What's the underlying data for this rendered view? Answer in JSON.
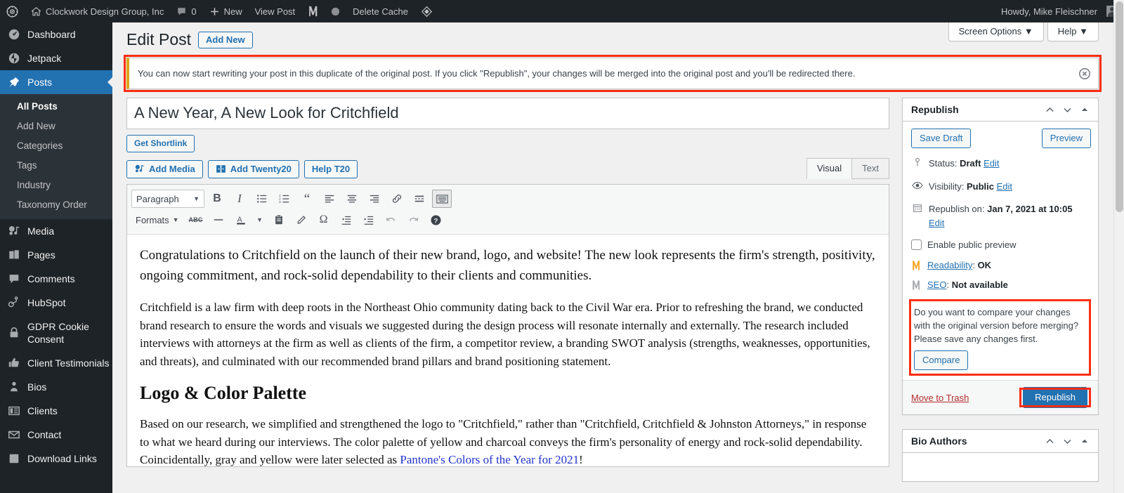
{
  "adminbar": {
    "wp_logo": "wordpress-icon",
    "site_name": "Clockwork Design Group, Inc",
    "comments_count": "0",
    "new_label": "New",
    "view_post_label": "View Post",
    "delete_cache_label": "Delete Cache",
    "howdy": "Howdy, Mike Fleischner"
  },
  "sidebar": {
    "items": [
      {
        "label": "Dashboard",
        "icon": "dashboard-icon",
        "current": false
      },
      {
        "label": "Jetpack",
        "icon": "jetpack-icon",
        "current": false
      },
      {
        "label": "Posts",
        "icon": "pin-icon",
        "current": true
      },
      {
        "label": "Media",
        "icon": "media-icon",
        "current": false
      },
      {
        "label": "Pages",
        "icon": "pages-icon",
        "current": false
      },
      {
        "label": "Comments",
        "icon": "comments-icon",
        "current": false
      },
      {
        "label": "HubSpot",
        "icon": "hubspot-icon",
        "current": false
      },
      {
        "label": "GDPR Cookie Consent",
        "icon": "lock-icon",
        "current": false
      },
      {
        "label": "Client Testimonials",
        "icon": "thumbs-up-icon",
        "current": false
      },
      {
        "label": "Bios",
        "icon": "person-icon",
        "current": false
      },
      {
        "label": "Clients",
        "icon": "list-view-icon",
        "current": false
      },
      {
        "label": "Contact",
        "icon": "email-icon",
        "current": false
      },
      {
        "label": "Download Links",
        "icon": "download-icon",
        "current": false
      }
    ],
    "posts_submenu": [
      {
        "label": "All Posts",
        "current": true
      },
      {
        "label": "Add New",
        "current": false
      },
      {
        "label": "Categories",
        "current": false
      },
      {
        "label": "Tags",
        "current": false
      },
      {
        "label": "Industry",
        "current": false
      },
      {
        "label": "Taxonomy Order",
        "current": false
      }
    ]
  },
  "screen_meta": {
    "screen_options": "Screen Options",
    "help": "Help"
  },
  "header": {
    "page_title": "Edit Post",
    "add_new": "Add New"
  },
  "notice": {
    "text": "You can now start rewriting your post in this duplicate of the original post. If you click \"Republish\", your changes will be merged into the original post and you'll be redirected there.",
    "dismiss": "dismiss-icon",
    "accent_color": "#dba617",
    "highlight_color": "#fa2e11"
  },
  "title_field": {
    "value": "A New Year, A New Look for Critchfield",
    "placeholder": "Add title"
  },
  "shortlink_button": "Get Shortlink",
  "editor": {
    "media_buttons": [
      {
        "label": "Add Media",
        "icon": "add-media-icon"
      },
      {
        "label": "Add Twenty20",
        "icon": "twenty20-icon"
      },
      {
        "label": "Help T20",
        "icon": ""
      }
    ],
    "tabs": [
      {
        "label": "Visual",
        "active": true
      },
      {
        "label": "Text",
        "active": false
      }
    ],
    "format_select": "Paragraph",
    "toolbar_row1": [
      {
        "name": "bold-icon",
        "glyph": "B"
      },
      {
        "name": "italic-icon",
        "glyph": "I"
      },
      {
        "name": "bulleted-list-icon",
        "glyph": ""
      },
      {
        "name": "numbered-list-icon",
        "glyph": ""
      },
      {
        "name": "blockquote-icon",
        "glyph": "“"
      },
      {
        "name": "align-left-icon",
        "glyph": ""
      },
      {
        "name": "align-center-icon",
        "glyph": ""
      },
      {
        "name": "align-right-icon",
        "glyph": ""
      },
      {
        "name": "insert-link-icon",
        "glyph": ""
      },
      {
        "name": "read-more-icon",
        "glyph": ""
      },
      {
        "name": "toolbar-toggle-icon",
        "glyph": ""
      }
    ],
    "toolbar_row2": [
      {
        "name": "formats-dropdown",
        "glyph": "Formats"
      },
      {
        "name": "strikethrough-icon",
        "glyph": "ABC"
      },
      {
        "name": "horizontal-line-icon",
        "glyph": ""
      },
      {
        "name": "text-color-icon",
        "glyph": "A"
      },
      {
        "name": "paste-as-text-icon",
        "glyph": ""
      },
      {
        "name": "clear-formatting-icon",
        "glyph": ""
      },
      {
        "name": "special-character-icon",
        "glyph": "Ω"
      },
      {
        "name": "decrease-indent-icon",
        "glyph": ""
      },
      {
        "name": "increase-indent-icon",
        "glyph": ""
      },
      {
        "name": "undo-icon",
        "glyph": ""
      },
      {
        "name": "redo-icon",
        "glyph": ""
      },
      {
        "name": "keyboard-shortcuts-icon",
        "glyph": "?"
      }
    ],
    "content": {
      "p1": "Congratulations to Critchfield on the launch of their new brand, logo, and website! The new look represents the firm's strength, positivity, ongoing commitment, and rock-solid dependability to their clients and communities.",
      "p2": "Critchfield is a law firm with deep roots in the Northeast Ohio community dating back to the Civil War era. Prior to refreshing the brand, we conducted brand research to ensure the words and visuals we suggested during the design process will resonate internally and externally. The research included interviews with attorneys at the firm as well as clients of the firm, a competitor review, a branding SWOT analysis (strengths, weaknesses, opportunities, and threats), and culminated with our recommended brand pillars and brand positioning statement.",
      "h2": "Logo & Color Palette",
      "p3_before_link": "Based on our research, we simplified and strengthened the logo to \"Critchfield,\" rather than \"Critchfield, Critchfield & Johnston Attorneys,\" in response to what we heard during our interviews. The color palette of yellow and charcoal conveys the firm's personality of energy and rock-solid dependability. Coincidentally, gray and yellow were later selected as ",
      "p3_link": "Pantone's Colors of the Year for 2021",
      "p3_after_link": "!"
    }
  },
  "republish_box": {
    "title": "Republish",
    "save_draft": "Save Draft",
    "preview": "Preview",
    "status_label": "Status:",
    "status_value": "Draft",
    "status_edit": "Edit",
    "visibility_label": "Visibility:",
    "visibility_value": "Public",
    "visibility_edit": "Edit",
    "schedule_label": "Republish on:",
    "schedule_value": "Jan 7, 2021 at 10:05",
    "schedule_edit": "Edit",
    "public_preview": "Enable public preview",
    "readability_label": "Readability",
    "readability_value": "OK",
    "seo_label": "SEO",
    "seo_value": "Not available",
    "compare_text": "Do you want to compare your changes with the original version before merging? Please save any changes first.",
    "compare_button": "Compare",
    "move_to_trash": "Move to Trash",
    "republish_button": "Republish"
  },
  "bio_authors_box": {
    "title": "Bio Authors"
  },
  "colors": {
    "wp_blue": "#2271b1",
    "sidebar_bg": "#1d2327",
    "submenu_bg": "#2c3338",
    "highlight_red": "#fa2e11",
    "notice_yellow": "#dba617",
    "link_blue": "#2271b1",
    "trash_red": "#b32d2e"
  }
}
